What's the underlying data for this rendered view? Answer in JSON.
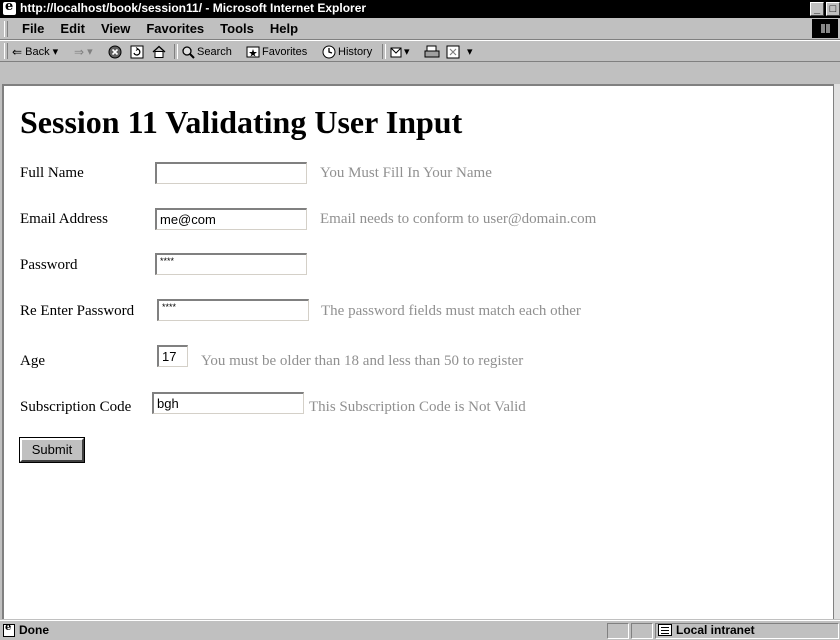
{
  "window": {
    "title": "http://localhost/book/session11/ - Microsoft Internet Explorer"
  },
  "menu": [
    "File",
    "Edit",
    "View",
    "Favorites",
    "Tools",
    "Help"
  ],
  "toolbar": {
    "back": "Back",
    "search": "Search",
    "favorites": "Favorites",
    "history": "History"
  },
  "page": {
    "title": "Session 11 Validating User Input",
    "fields": {
      "full_name": {
        "label": "Full Name",
        "value": "",
        "message": "You Must Fill In Your Name"
      },
      "email": {
        "label": "Email Address",
        "value": "me@com",
        "message": "Email needs to conform to user@domain.com"
      },
      "password": {
        "label": "Password",
        "value": "****",
        "message": ""
      },
      "reenter_password": {
        "label": "Re Enter Password",
        "value": "****",
        "message": "The password fields must match each other"
      },
      "age": {
        "label": "Age",
        "value": "17",
        "message": "You must be older than 18 and less than 50 to register"
      },
      "subscription_code": {
        "label": "Subscription Code",
        "value": "bgh",
        "message": "This Subscription Code is Not Valid"
      }
    },
    "submit_label": "Submit"
  },
  "status": {
    "text": "Done",
    "zone": "Local intranet"
  }
}
